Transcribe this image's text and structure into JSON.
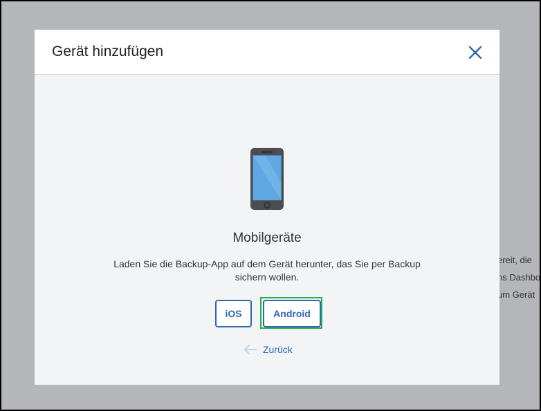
{
  "background_page": {
    "lines": [
      "ereit, die",
      "ns Dashbo",
      "um Gerät"
    ]
  },
  "dialog": {
    "title": "Gerät hinzufügen",
    "close_icon": "close-icon"
  },
  "content": {
    "device_icon": "mobile-phone-icon",
    "heading": "Mobilgeräte",
    "description": "Laden Sie die Backup-App auf dem Gerät herunter, das Sie per Backup sichern wollen.",
    "buttons": {
      "ios_label": "iOS",
      "android_label": "Android"
    },
    "back_label": "Zurück",
    "back_icon": "arrow-left-icon"
  },
  "colors": {
    "accent": "#2f67b1",
    "highlight": "#22b14c",
    "overlay": "#b5b6b9"
  }
}
